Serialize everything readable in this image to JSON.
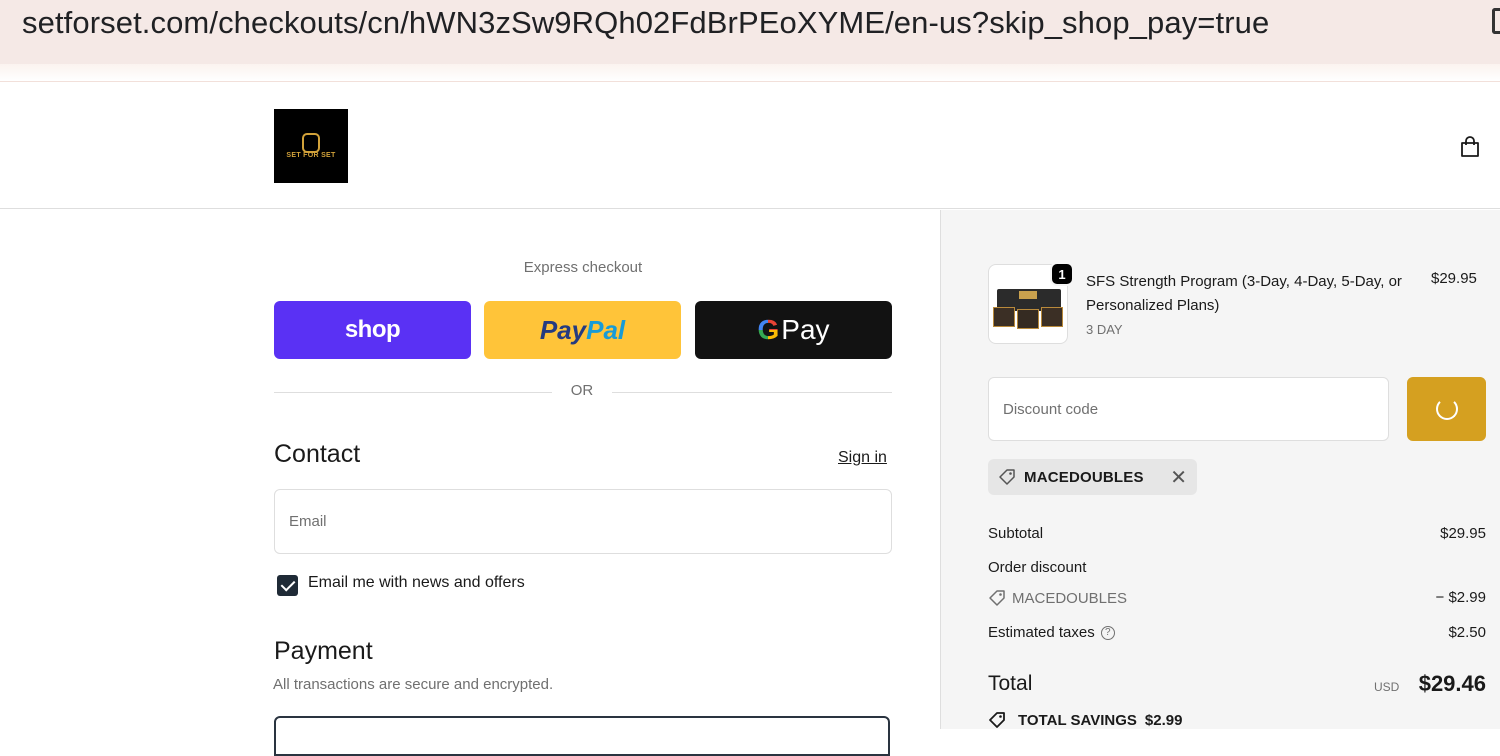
{
  "browser": {
    "url": "setforset.com/checkouts/cn/hWN3zSw9RQh02FdBrPEoXYME/en-us?skip_shop_pay=true"
  },
  "header": {
    "logo_text": "SET FOR SET",
    "cart_icon": "shopping-bag-icon"
  },
  "express": {
    "label": "Express checkout",
    "shop_label": "shop",
    "paypal_label_1": "Pay",
    "paypal_label_2": "Pal",
    "gpay_g": "G",
    "gpay_label": "Pay",
    "or_label": "OR"
  },
  "contact": {
    "title": "Contact",
    "sign_in": "Sign in",
    "email_placeholder": "Email",
    "email_value": "",
    "newsletter_label": "Email me with news and offers",
    "newsletter_checked": true
  },
  "payment": {
    "title": "Payment",
    "subtitle": "All transactions are secure and encrypted."
  },
  "summary": {
    "product": {
      "quantity": "1",
      "name": "SFS Strength Program (3-Day, 4-Day, 5-Day, or Personalized Plans)",
      "variant": "3 DAY",
      "price": "$29.95"
    },
    "discount_placeholder": "Discount code",
    "applied_code": "MACEDOUBLES",
    "subtotal_label": "Subtotal",
    "subtotal_value": "$29.95",
    "order_discount_label": "Order discount",
    "discount_code_label": "MACEDOUBLES",
    "discount_value": "− $2.99",
    "taxes_label": "Estimated taxes",
    "taxes_help": "?",
    "taxes_value": "$2.50",
    "total_label": "Total",
    "total_currency": "USD",
    "total_value": "$29.46",
    "savings_label": "TOTAL SAVINGS",
    "savings_value": "$2.99"
  },
  "colors": {
    "shop_purple": "#5a31f4",
    "paypal_yellow": "#ffc439",
    "gpay_black": "#121212",
    "apply_gold": "#d5a020"
  }
}
